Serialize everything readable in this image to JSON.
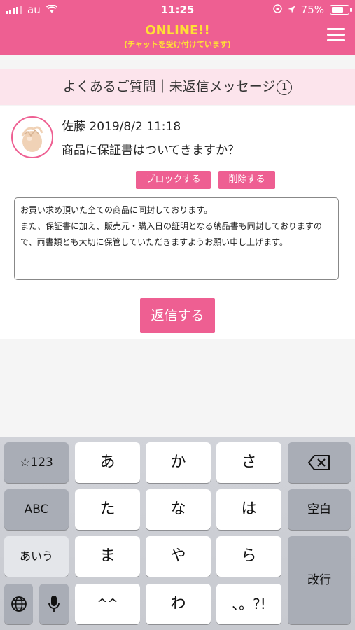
{
  "status_bar": {
    "carrier": "au",
    "time": "11:25",
    "battery": "75%"
  },
  "header": {
    "online": "ONLINE!!",
    "online_sub": "(チャットを受け付けています)"
  },
  "subheader": {
    "title": "よくあるご質問｜未返信メッセージ",
    "count": "1"
  },
  "message": {
    "sender": "佐藤",
    "timestamp": "2019/8/2 11:18",
    "text": "商品に保証書はついてきますか？",
    "block_label": "ブロックする",
    "delete_label": "削除する"
  },
  "reply": {
    "text": "お買い求め頂いた全ての商品に同封しております。\nまた、保証書に加え、販売元・購入日の証明となる納品書も同封しておりますので、両書類とも大切に保管していただきますようお願い申し上げます。",
    "button_label": "返信する"
  },
  "keyboard": {
    "row1": [
      "☆123",
      "あ",
      "か",
      "さ"
    ],
    "row2": [
      "ABC",
      "た",
      "な",
      "は",
      "空白"
    ],
    "row3": [
      "あいう",
      "ま",
      "や",
      "ら"
    ],
    "row4": [
      "^^",
      "わ",
      "、。?!"
    ],
    "return_label": "改行"
  }
}
